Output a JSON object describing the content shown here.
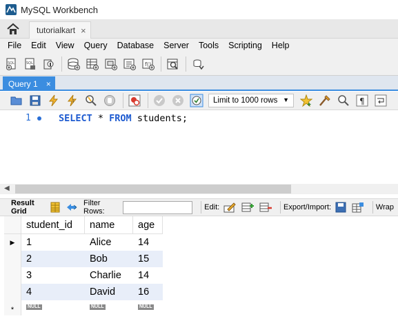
{
  "window": {
    "title": "MySQL Workbench"
  },
  "connection_tab": {
    "label": "tutorialkart",
    "close": "×"
  },
  "menu": [
    "File",
    "Edit",
    "View",
    "Query",
    "Database",
    "Server",
    "Tools",
    "Scripting",
    "Help"
  ],
  "query_tab": {
    "label": "Query 1",
    "close": "×"
  },
  "sql_toolbar": {
    "limit_label": "Limit to 1000 rows"
  },
  "editor": {
    "line_number": "1",
    "code": {
      "select": "SELECT",
      "star": " * ",
      "from": "FROM",
      "rest": " students;"
    }
  },
  "result_toolbar": {
    "result_grid_label": "Result Grid",
    "filter_rows_label": "Filter Rows:",
    "filter_value": "",
    "edit_label": "Edit:",
    "export_label": "Export/Import:",
    "wrap_label": "Wrap"
  },
  "grid": {
    "columns": [
      "student_id",
      "name",
      "age"
    ],
    "rows": [
      [
        "1",
        "Alice",
        "14"
      ],
      [
        "2",
        "Bob",
        "15"
      ],
      [
        "3",
        "Charlie",
        "14"
      ],
      [
        "4",
        "David",
        "16"
      ]
    ],
    "null_label": "NULL",
    "new_row_marker": "*",
    "current_row_marker": "▶"
  },
  "colors": {
    "accent": "#3b8de0",
    "keyword": "#1e5bd0",
    "alt_row": "#e8eef9"
  }
}
